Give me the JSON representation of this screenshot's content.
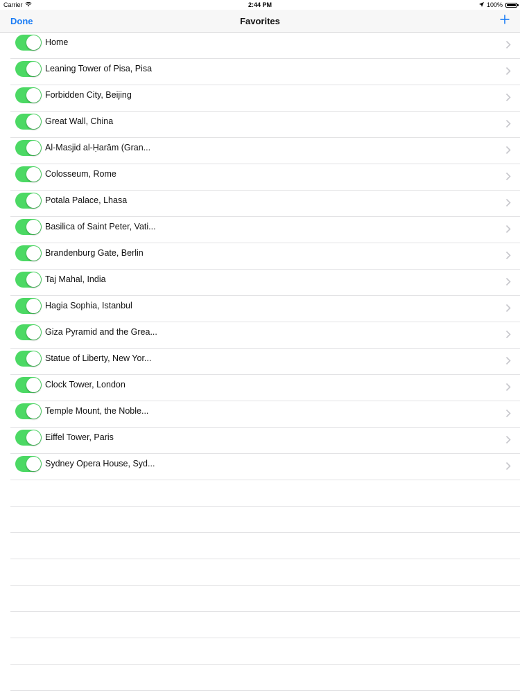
{
  "status_bar": {
    "carrier": "Carrier",
    "time": "2:44 PM",
    "battery": "100%",
    "battery_level": 1.0,
    "wifi_icon": "wifi-icon",
    "location_icon": "location-arrow-icon"
  },
  "nav": {
    "done_label": "Done",
    "title": "Favorites",
    "add_icon": "plus-icon"
  },
  "favorites": [
    {
      "label": "Home",
      "enabled": true
    },
    {
      "label": "Leaning Tower of Pisa, Pisa",
      "enabled": true
    },
    {
      "label": "Forbidden City, Beijing",
      "enabled": true
    },
    {
      "label": "Great Wall, China",
      "enabled": true
    },
    {
      "label": "Al-Masjid al-Ḥarām (Gran...",
      "enabled": true
    },
    {
      "label": "Colosseum, Rome",
      "enabled": true
    },
    {
      "label": "Potala Palace, Lhasa",
      "enabled": true
    },
    {
      "label": "Basilica of Saint Peter, Vati...",
      "enabled": true
    },
    {
      "label": "Brandenburg Gate, Berlin",
      "enabled": true
    },
    {
      "label": "Taj Mahal, India",
      "enabled": true
    },
    {
      "label": "Hagia Sophia, Istanbul",
      "enabled": true
    },
    {
      "label": "Giza Pyramid and the Grea...",
      "enabled": true
    },
    {
      "label": "Statue of Liberty, New Yor...",
      "enabled": true
    },
    {
      "label": "Clock Tower, London",
      "enabled": true
    },
    {
      "label": "Temple Mount, the Noble...",
      "enabled": true
    },
    {
      "label": "Eiffel Tower, Paris",
      "enabled": true
    },
    {
      "label": "Sydney Opera House, Syd...",
      "enabled": true
    }
  ],
  "colors": {
    "accent": "#1a7cf5",
    "toggle_on": "#4cd964",
    "chevron": "#c7c7cc"
  }
}
